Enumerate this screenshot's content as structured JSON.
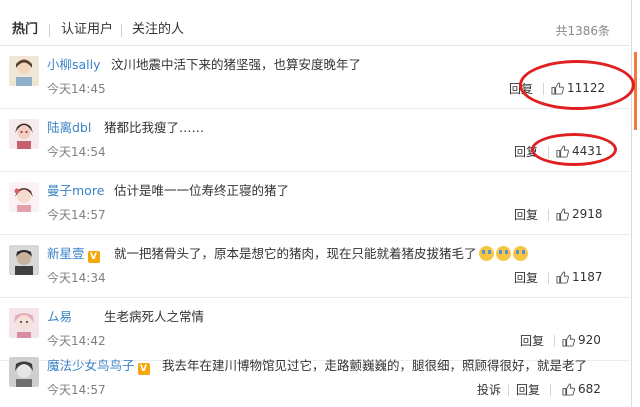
{
  "tabs": [
    {
      "label": "热门",
      "active": true
    },
    {
      "label": "认证用户",
      "active": false
    },
    {
      "label": "关注的人",
      "active": false
    }
  ],
  "total_count": "共1386条",
  "comments": [
    {
      "user": "小柳sally",
      "verified": false,
      "text": "汶川地震中活下来的猪坚强，也算安度晚年了",
      "time": "今天14:45",
      "reply": "回复",
      "likes": "11122",
      "highlighted": true
    },
    {
      "user": "陆离dbl",
      "verified": false,
      "text": "猪都比我瘦了……",
      "time": "今天14:54",
      "reply": "回复",
      "likes": "4431",
      "highlighted": true
    },
    {
      "user": "曼子more",
      "verified": false,
      "text": "估计是唯一一位寿终正寝的猪了",
      "time": "今天14:57",
      "reply": "回复",
      "likes": "2918",
      "highlighted": false
    },
    {
      "user": "新星壹",
      "verified": true,
      "text": "就一把猪骨头了，原本是想它的猪肉，现在只能就着猪皮拔猪毛了",
      "emoji_count": 3,
      "time": "今天14:34",
      "reply": "回复",
      "likes": "1187",
      "highlighted": false
    },
    {
      "user": "ム易",
      "verified": false,
      "text": "生老病死人之常情",
      "time": "今天14:42",
      "reply": "回复",
      "likes": "920",
      "highlighted": false
    },
    {
      "user": "魔法少女鸟鸟子",
      "verified": true,
      "text": "我去年在建川博物馆见过它，走路颤巍巍的，腿很细，照顾得很好，就是老了",
      "time": "今天14:57",
      "report": "投诉",
      "reply": "回复",
      "likes": "682",
      "highlighted": false
    }
  ],
  "colors": {
    "username": "#3a82c6",
    "highlight_circle": "#e02020",
    "verified_badge": "#f4a80c"
  },
  "icons": {
    "like": "thumbs-up-icon",
    "verified": "verified-v-icon",
    "emoji": "crying-laughing-emoji"
  }
}
